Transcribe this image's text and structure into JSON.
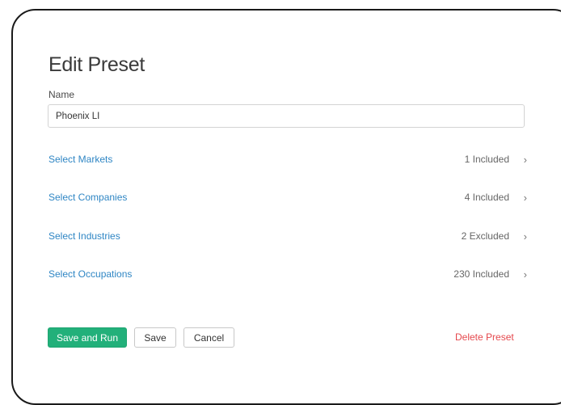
{
  "dialog": {
    "title": "Edit Preset",
    "name_label": "Name",
    "name_value": "Phoenix LI"
  },
  "selections": [
    {
      "label": "Select Markets",
      "status": "1 Included",
      "chevron": "chevron-right-icon"
    },
    {
      "label": "Select Companies",
      "status": "4 Included",
      "chevron": "chevron-right-icon"
    },
    {
      "label": "Select Industries",
      "status": "2 Excluded",
      "chevron": "chevron-right-icon"
    },
    {
      "label": "Select Occupations",
      "status": "230 Included",
      "chevron": "chevron-right-icon"
    }
  ],
  "actions": {
    "save_and_run": "Save and Run",
    "save": "Save",
    "cancel": "Cancel",
    "delete": "Delete Preset"
  },
  "colors": {
    "link": "#2f86c4",
    "primary": "#22b07a",
    "danger": "#e5484d"
  }
}
